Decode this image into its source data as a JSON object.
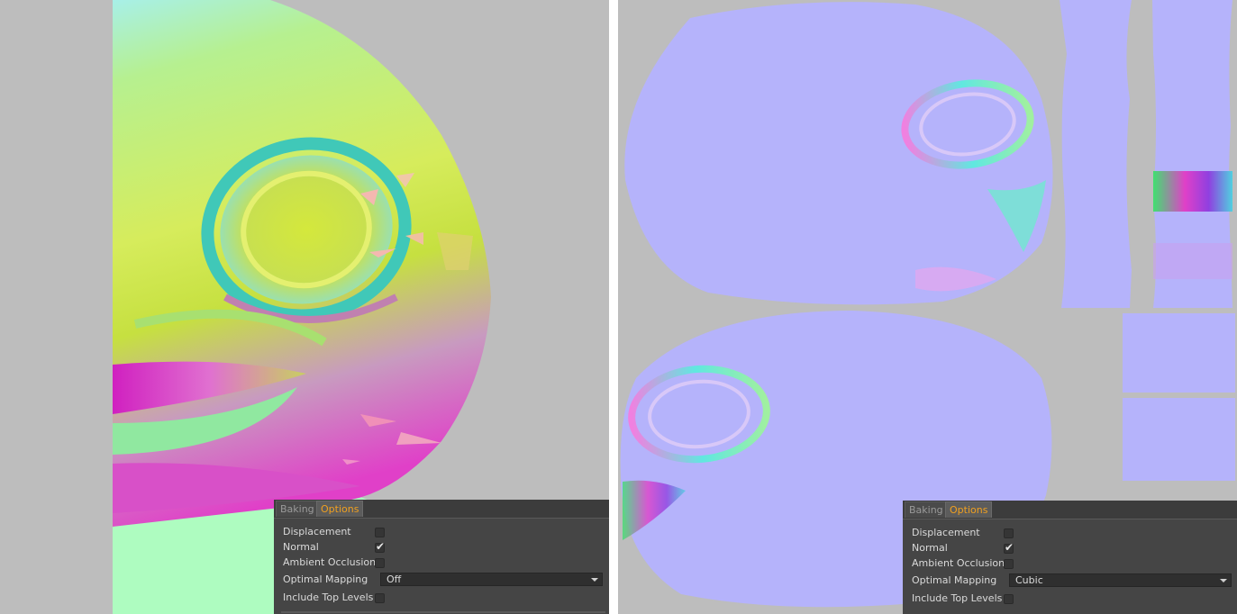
{
  "panels": {
    "left": {
      "tabs": [
        "Baking",
        "Options"
      ],
      "displacement_label": "Displacement",
      "normal_label": "Normal",
      "ambient_occlusion_label": "Ambient Occlusion",
      "optimal_mapping_label": "Optimal Mapping",
      "optimal_mapping_value": "Off",
      "include_top_levels_label": "Include Top Levels",
      "checkboxes": {
        "displacement": false,
        "normal": true,
        "ambient_occlusion": false,
        "include_top_levels": false
      }
    },
    "right": {
      "tabs": [
        "Baking",
        "Options"
      ],
      "displacement_label": "Displacement",
      "normal_label": "Normal",
      "ambient_occlusion_label": "Ambient Occlusion",
      "optimal_mapping_label": "Optimal Mapping",
      "optimal_mapping_value": "Cubic",
      "include_top_levels_label": "Include Top Levels",
      "checkboxes": {
        "displacement": false,
        "normal": true,
        "ambient_occlusion": false,
        "include_top_levels": false
      }
    }
  },
  "icons": {
    "check": "check-mark-icon",
    "dropdown": "chevron-down-icon"
  },
  "colors": {
    "viewport_bg": "#bdbdbd",
    "panel_bg": "#454545",
    "active_tab": "#f0a020",
    "normal_map_base": "#b5b3fb"
  }
}
